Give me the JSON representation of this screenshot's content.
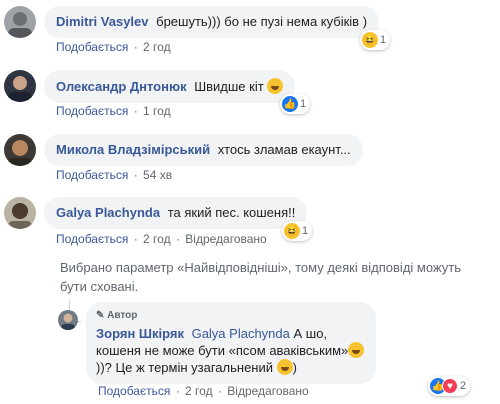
{
  "comments": [
    {
      "author": "Dimitri Vasylev",
      "text": "брешуть))) бо не пузі нема кубіків )",
      "reaction_count": "1",
      "like": "Подобається",
      "time": "2 год"
    },
    {
      "author": "Олександр Днтонюк",
      "text": "Швидше кіт",
      "reaction_count": "1",
      "like": "Подобається",
      "time": "1 год"
    },
    {
      "author": "Микола Владзімірський",
      "text": "хтось зламав екаунт...",
      "like": "Подобається",
      "time": "54 хв"
    },
    {
      "author": "Galya Plachynda",
      "text": "та який пес. кошеня!!",
      "reaction_count": "1",
      "like": "Подобається",
      "time": "2 год",
      "edited": "Відредаговано"
    }
  ],
  "notice": "Вибрано параметр «Найвідповідніші», тому деякі відповіді можуть бути сховані.",
  "reply": {
    "badge": "Автор",
    "author": "Зорян Шкіряк",
    "mention": "Galya Plachynda",
    "text_part1": "А шо, кошеня не може бути «псом аваківським»",
    "text_part2": "))? Це ж термін узагальнений",
    "text_part3": ")",
    "reaction_count": "2",
    "like": "Подобається",
    "time": "2 год",
    "edited": "Відредаговано"
  },
  "separator": "·",
  "colors": {
    "link": "#385898",
    "bubble": "#f2f3f5",
    "meta": "#606770",
    "like_blue": "#1877f2"
  }
}
